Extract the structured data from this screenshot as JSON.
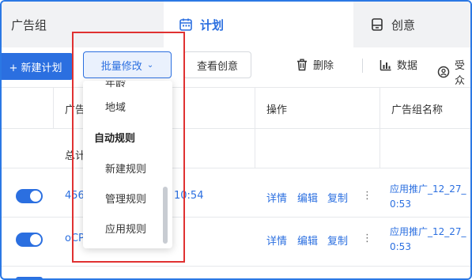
{
  "tabs": {
    "ad_group": "广告组",
    "plan": "计划",
    "creative": "创意"
  },
  "toolbar": {
    "new_plan": "+ 新建计划",
    "batch_edit": "批量修改",
    "batch_chevron": "⌄",
    "view_creative": "查看创意",
    "delete": "删除",
    "data": "数据",
    "recv": "受众"
  },
  "table": {
    "headers": {
      "col_ad": "广告",
      "col_ops": "操作",
      "col_group_name": "广告组名称"
    },
    "summary_label": "总计",
    "rows": [
      {
        "id_fragment": "456",
        "time_fragment": "10:54",
        "detail": "详情",
        "edit": "编辑",
        "copy": "复制",
        "more": "⋮",
        "group_name_line1": "应用推广_12_27_",
        "group_name_line2": "0:53"
      },
      {
        "id_fragment": "oCP",
        "time_fragment": "",
        "detail": "详情",
        "edit": "编辑",
        "copy": "复制",
        "more": "⋮",
        "group_name_line1": "应用推广_12_27_",
        "group_name_line2": "0:53"
      }
    ]
  },
  "dropdown": {
    "items": [
      {
        "label": "年龄",
        "type": "sub"
      },
      {
        "label": "地域",
        "type": "sub"
      },
      {
        "label": "自动规则",
        "type": "group"
      },
      {
        "label": "新建规则",
        "type": "sub"
      },
      {
        "label": "管理规则",
        "type": "sub"
      },
      {
        "label": "应用规则",
        "type": "sub"
      }
    ]
  },
  "colors": {
    "accent": "#2b6fe0",
    "highlight": "#e03131"
  }
}
